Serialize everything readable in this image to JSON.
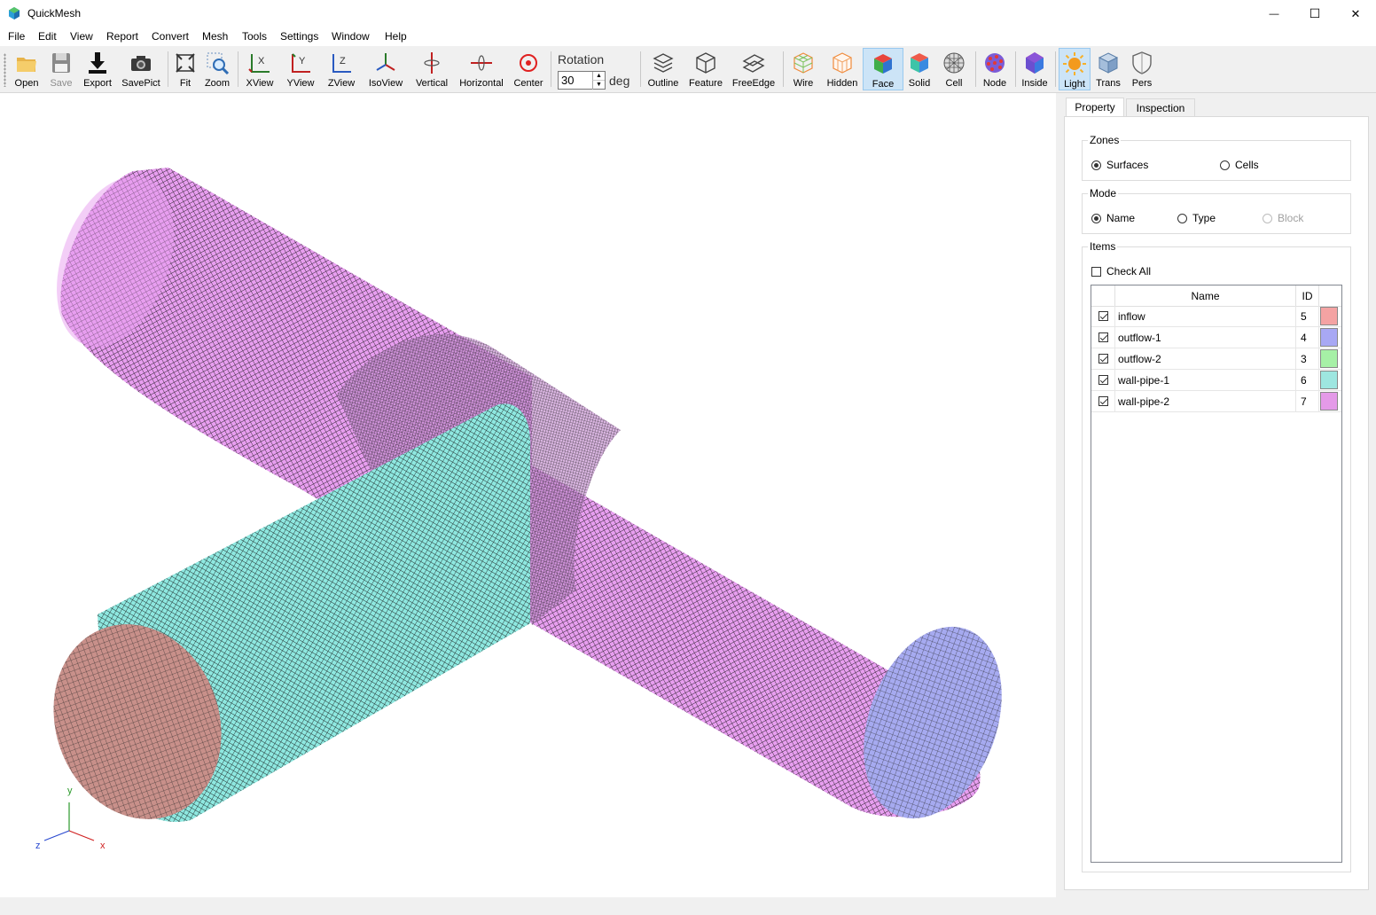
{
  "window": {
    "title": "QuickMesh",
    "controls": {
      "minimize": "—",
      "maximize": "☐",
      "close": "✕"
    }
  },
  "menu": [
    "File",
    "Edit",
    "View",
    "Report",
    "Convert",
    "Mesh",
    "Tools",
    "Settings",
    "Window",
    "Help"
  ],
  "toolbar": {
    "groups": [
      [
        {
          "id": "open",
          "label": "Open",
          "icon": "folder-icon"
        },
        {
          "id": "save",
          "label": "Save",
          "icon": "floppy-disk-icon",
          "disabled": true
        },
        {
          "id": "export",
          "label": "Export",
          "icon": "download-arrow-icon"
        },
        {
          "id": "savepict",
          "label": "SavePict",
          "icon": "camera-icon"
        }
      ],
      [
        {
          "id": "fit",
          "label": "Fit",
          "icon": "fit-arrows-icon"
        },
        {
          "id": "zoom",
          "label": "Zoom",
          "icon": "zoom-magnifier-icon"
        }
      ],
      [
        {
          "id": "xview",
          "label": "XView",
          "icon": "x-axis-view-icon"
        },
        {
          "id": "yview",
          "label": "YView",
          "icon": "y-axis-view-icon"
        },
        {
          "id": "zview",
          "label": "ZView",
          "icon": "z-axis-view-icon"
        },
        {
          "id": "isoview",
          "label": "IsoView",
          "icon": "isometric-view-icon"
        },
        {
          "id": "vertical",
          "label": "Vertical",
          "icon": "vertical-rotate-icon"
        },
        {
          "id": "horizontal",
          "label": "Horizontal",
          "icon": "horizontal-rotate-icon"
        },
        {
          "id": "center",
          "label": "Center",
          "icon": "center-target-icon"
        }
      ],
      [
        {
          "id": "outline",
          "label": "Outline",
          "icon": "outline-layers-icon"
        },
        {
          "id": "feature",
          "label": "Feature",
          "icon": "feature-cube-icon"
        },
        {
          "id": "freeedge",
          "label": "FreeEdge",
          "icon": "free-edge-icon"
        }
      ],
      [
        {
          "id": "wire",
          "label": "Wire",
          "icon": "wire-cube-icon"
        },
        {
          "id": "hidden",
          "label": "Hidden",
          "icon": "hidden-cube-icon"
        },
        {
          "id": "face",
          "label": "Face",
          "icon": "face-cube-icon",
          "active": true
        },
        {
          "id": "solid",
          "label": "Solid",
          "icon": "solid-cube-icon"
        },
        {
          "id": "cell",
          "label": "Cell",
          "icon": "cell-sphere-icon"
        }
      ],
      [
        {
          "id": "node",
          "label": "Node",
          "icon": "node-sphere-icon"
        }
      ],
      [
        {
          "id": "inside",
          "label": "Inside",
          "icon": "inside-hexagon-icon"
        }
      ],
      [
        {
          "id": "light",
          "label": "Light",
          "icon": "sun-icon",
          "active": true
        },
        {
          "id": "trans",
          "label": "Trans",
          "icon": "transparent-cube-icon"
        },
        {
          "id": "pers",
          "label": "Pers",
          "icon": "perspective-shield-icon"
        }
      ]
    ],
    "rotation": {
      "label": "Rotation",
      "value": "30",
      "unit": "deg"
    }
  },
  "viewport": {
    "axes": {
      "x": "x",
      "y": "y",
      "z": "z"
    },
    "colors": {
      "inflow": "#c8908a",
      "outflow1": "#a6aaf0",
      "wallpipe1": "#8ee8e0",
      "wallpipe2": "#e89ef0",
      "mesh": "#111111"
    }
  },
  "panel": {
    "tabs": [
      "Property",
      "Inspection"
    ],
    "zones": {
      "label": "Zones",
      "options": [
        {
          "label": "Surfaces",
          "selected": true
        },
        {
          "label": "Cells",
          "selected": false
        }
      ]
    },
    "mode": {
      "label": "Mode",
      "options": [
        {
          "label": "Name",
          "selected": true
        },
        {
          "label": "Type",
          "selected": false
        },
        {
          "label": "Block",
          "selected": false,
          "disabled": true
        }
      ]
    },
    "items": {
      "label": "Items",
      "check_all": "Check All",
      "columns": {
        "name": "Name",
        "id": "ID"
      },
      "rows": [
        {
          "name": "inflow",
          "id": "5",
          "color": "#f4a3a3",
          "checked": true
        },
        {
          "name": "outflow-1",
          "id": "4",
          "color": "#a8a8f4",
          "checked": true
        },
        {
          "name": "outflow-2",
          "id": "3",
          "color": "#a6f0a6",
          "checked": true
        },
        {
          "name": "wall-pipe-1",
          "id": "6",
          "color": "#9ee6e0",
          "checked": true
        },
        {
          "name": "wall-pipe-2",
          "id": "7",
          "color": "#e49ae8",
          "checked": true
        }
      ]
    }
  }
}
